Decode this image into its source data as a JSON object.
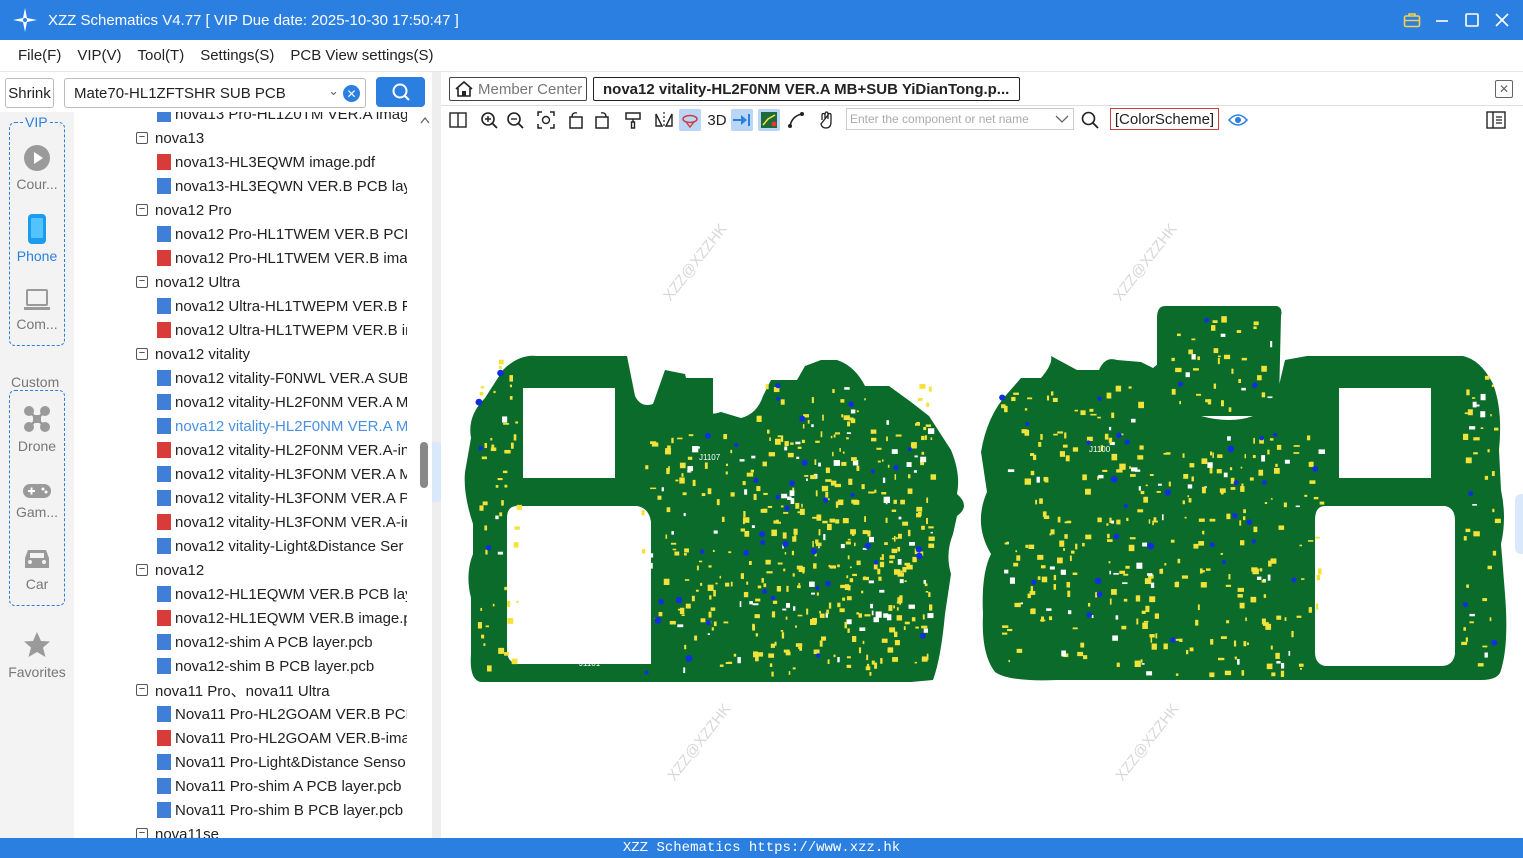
{
  "app": {
    "title": "XZZ Schematics V4.77 [ VIP Due date: 2025-10-30 17:50:47 ]",
    "status_text": "XZZ Schematics https://www.xzz.hk",
    "accent": "#2b7fe0"
  },
  "menu": [
    "File(F)",
    "VIP(V)",
    "Tool(T)",
    "Settings(S)",
    "PCB View settings(S)"
  ],
  "search": {
    "shrink_label": "Shrink",
    "model_value": "Mate70-HL1ZFTSHR SUB PCB",
    "search_icon": "search-icon"
  },
  "sidebar": {
    "vip_label": "VIP",
    "custom_label": "Custom",
    "items": [
      {
        "label": "Cour...",
        "icon": "play-circle-icon"
      },
      {
        "label": "Phone",
        "icon": "phone-icon"
      },
      {
        "label": "Com...",
        "icon": "laptop-icon"
      },
      {
        "label": "Drone",
        "icon": "drone-icon"
      },
      {
        "label": "Gam...",
        "icon": "gamepad-icon"
      },
      {
        "label": "Car",
        "icon": "car-icon"
      },
      {
        "label": "Favorites",
        "icon": "star-icon"
      }
    ]
  },
  "tree": [
    {
      "type": "file",
      "kind": "pcb",
      "label": "nova13 Pro-HL1Z0TM VER.A imag"
    },
    {
      "type": "group",
      "label": "nova13"
    },
    {
      "type": "file",
      "kind": "pdf",
      "label": "nova13-HL3EQWM image.pdf"
    },
    {
      "type": "file",
      "kind": "pcb",
      "label": "nova13-HL3EQWN VER.B PCB layer"
    },
    {
      "type": "group",
      "label": "nova12 Pro"
    },
    {
      "type": "file",
      "kind": "pcb",
      "label": "nova12 Pro-HL1TWEM VER.B PCB l"
    },
    {
      "type": "file",
      "kind": "pdf",
      "label": "nova12 Pro-HL1TWEM VER.B imag"
    },
    {
      "type": "group",
      "label": "nova12 Ultra"
    },
    {
      "type": "file",
      "kind": "pcb",
      "label": "nova12 Ultra-HL1TWEPM VER.B PC"
    },
    {
      "type": "file",
      "kind": "pdf",
      "label": "nova12 Ultra-HL1TWEPM VER.B im"
    },
    {
      "type": "group",
      "label": "nova12 vitality"
    },
    {
      "type": "file",
      "kind": "pcb",
      "label": "nova12 vitality-F0NWL VER.A SUB I"
    },
    {
      "type": "file",
      "kind": "pcb",
      "label": "nova12 vitality-HL2F0NM VER.A M"
    },
    {
      "type": "file",
      "kind": "pcb",
      "label": "nova12 vitality-HL2F0NM VER.A M",
      "selected": true
    },
    {
      "type": "file",
      "kind": "pdf",
      "label": "nova12 vitality-HL2F0NM VER.A-in"
    },
    {
      "type": "file",
      "kind": "pcb",
      "label": "nova12 vitality-HL3FONM VER.A M"
    },
    {
      "type": "file",
      "kind": "pcb",
      "label": "nova12 vitality-HL3FONM VER.A P("
    },
    {
      "type": "file",
      "kind": "pdf",
      "label": "nova12 vitality-HL3FONM VER.A-ir"
    },
    {
      "type": "file",
      "kind": "pcb",
      "label": "nova12 vitality-Light&Distance Ser"
    },
    {
      "type": "group",
      "label": "nova12"
    },
    {
      "type": "file",
      "kind": "pcb",
      "label": "nova12-HL1EQWM VER.B PCB laye"
    },
    {
      "type": "file",
      "kind": "pdf",
      "label": "nova12-HL1EQWM VER.B image.p("
    },
    {
      "type": "file",
      "kind": "pcb",
      "label": "nova12-shim A PCB layer.pcb"
    },
    {
      "type": "file",
      "kind": "pcb",
      "label": "nova12-shim B PCB layer.pcb"
    },
    {
      "type": "group",
      "label": "nova11 Pro、nova11 Ultra"
    },
    {
      "type": "file",
      "kind": "pcb",
      "label": "Nova11 Pro-HL2GOAM VER.B PCB"
    },
    {
      "type": "file",
      "kind": "pdf",
      "label": "Nova11 Pro-HL2GOAM VER.B-imag"
    },
    {
      "type": "file",
      "kind": "pcb",
      "label": "Nova11 Pro-Light&Distance Senso"
    },
    {
      "type": "file",
      "kind": "pcb",
      "label": "Nova11 Pro-shim A PCB layer.pcb"
    },
    {
      "type": "file",
      "kind": "pcb",
      "label": "Nova11 Pro-shim B PCB layer.pcb"
    },
    {
      "type": "group",
      "label": "nova11se"
    }
  ],
  "tabs": {
    "member_center": "Member Center",
    "document": "nova12 vitality-HL2F0NM VER.A MB+SUB YiDianTong.p..."
  },
  "viewer": {
    "label_3d": "3D",
    "component_search_placeholder": "Enter the component or net name",
    "color_scheme": "[ColorScheme]",
    "watermark": "XZZ@XZZHK",
    "board_color": "#0b6b2a",
    "pad_color": "#f2e23a",
    "via_color": "#1030e0",
    "silk_labels": [
      "J1101",
      "J1107",
      "J1100"
    ]
  }
}
